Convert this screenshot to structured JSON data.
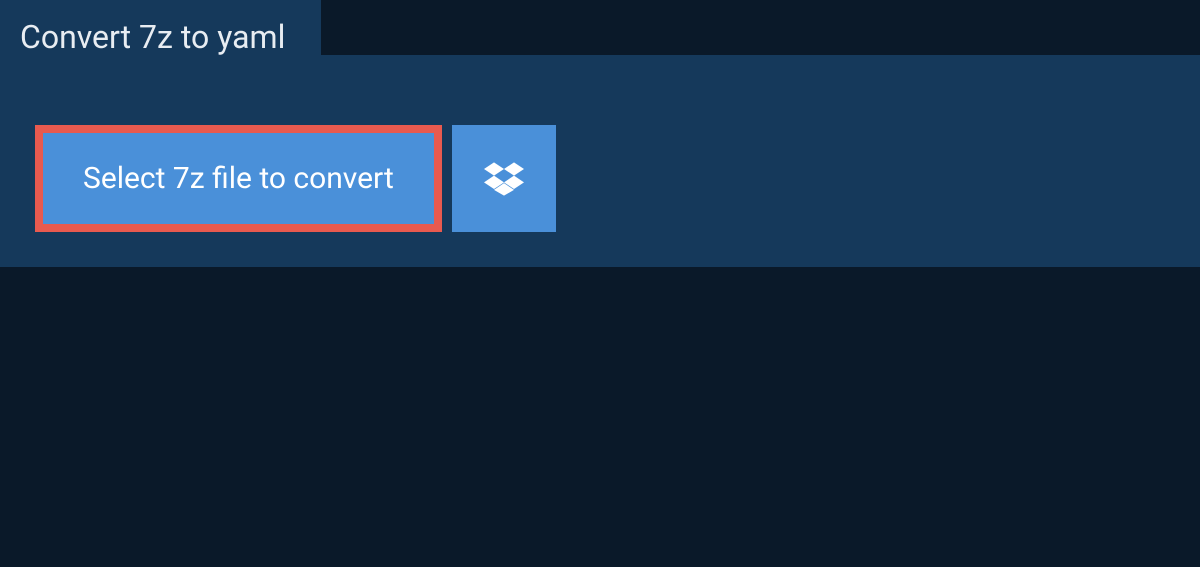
{
  "tab": {
    "title": "Convert 7z to yaml"
  },
  "buttons": {
    "select_file_label": "Select 7z file to convert"
  },
  "colors": {
    "background_dark": "#0a1929",
    "panel": "#15395b",
    "button_primary": "#4a90d9",
    "highlight_border": "#e85a4f",
    "text_light": "#e8edf2",
    "text_white": "#ffffff"
  }
}
